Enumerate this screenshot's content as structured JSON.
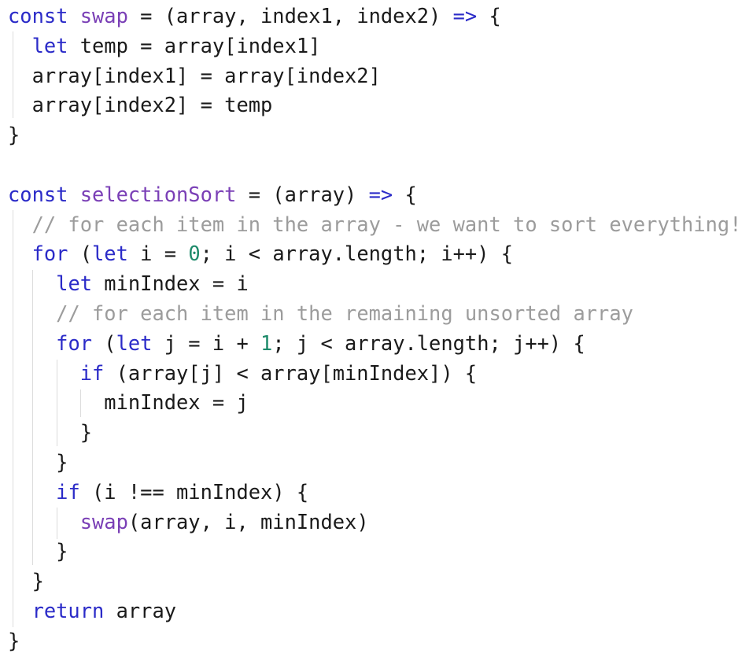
{
  "lines": [
    [
      {
        "t": "const ",
        "c": "kw"
      },
      {
        "t": "swap",
        "c": "fn"
      },
      {
        "t": " = (array, index1, index2) ",
        "c": ""
      },
      {
        "t": "=>",
        "c": "kw"
      },
      {
        "t": " {",
        "c": ""
      }
    ],
    [
      {
        "t": "  ",
        "c": ""
      },
      {
        "t": "let",
        "c": "kw"
      },
      {
        "t": " temp = array[index1]",
        "c": ""
      }
    ],
    [
      {
        "t": "  array[index1] = array[index2]",
        "c": ""
      }
    ],
    [
      {
        "t": "  array[index2] = temp",
        "c": ""
      }
    ],
    [
      {
        "t": "}",
        "c": ""
      }
    ],
    [
      {
        "t": "",
        "c": ""
      }
    ],
    [
      {
        "t": "const ",
        "c": "kw"
      },
      {
        "t": "selectionSort",
        "c": "fn"
      },
      {
        "t": " = (array) ",
        "c": ""
      },
      {
        "t": "=>",
        "c": "kw"
      },
      {
        "t": " {",
        "c": ""
      }
    ],
    [
      {
        "t": "  ",
        "c": ""
      },
      {
        "t": "// for each item in the array - we want to sort everything!",
        "c": "cm"
      }
    ],
    [
      {
        "t": "  ",
        "c": ""
      },
      {
        "t": "for",
        "c": "kw"
      },
      {
        "t": " (",
        "c": ""
      },
      {
        "t": "let",
        "c": "kw"
      },
      {
        "t": " i = ",
        "c": ""
      },
      {
        "t": "0",
        "c": "num"
      },
      {
        "t": "; i < array.length; i++) {",
        "c": ""
      }
    ],
    [
      {
        "t": "    ",
        "c": ""
      },
      {
        "t": "let",
        "c": "kw"
      },
      {
        "t": " minIndex = i",
        "c": ""
      }
    ],
    [
      {
        "t": "    ",
        "c": ""
      },
      {
        "t": "// for each item in the remaining unsorted array",
        "c": "cm"
      }
    ],
    [
      {
        "t": "    ",
        "c": ""
      },
      {
        "t": "for",
        "c": "kw"
      },
      {
        "t": " (",
        "c": ""
      },
      {
        "t": "let",
        "c": "kw"
      },
      {
        "t": " j = i + ",
        "c": ""
      },
      {
        "t": "1",
        "c": "num"
      },
      {
        "t": "; j < array.length; j++) {",
        "c": ""
      }
    ],
    [
      {
        "t": "      ",
        "c": ""
      },
      {
        "t": "if",
        "c": "kw"
      },
      {
        "t": " (array[j] < array[minIndex]) {",
        "c": ""
      }
    ],
    [
      {
        "t": "        minIndex = j",
        "c": ""
      }
    ],
    [
      {
        "t": "      }",
        "c": ""
      }
    ],
    [
      {
        "t": "    }",
        "c": ""
      }
    ],
    [
      {
        "t": "    ",
        "c": ""
      },
      {
        "t": "if",
        "c": "kw"
      },
      {
        "t": " (i !== minIndex) {",
        "c": ""
      }
    ],
    [
      {
        "t": "      ",
        "c": ""
      },
      {
        "t": "swap",
        "c": "fn"
      },
      {
        "t": "(array, i, minIndex)",
        "c": ""
      }
    ],
    [
      {
        "t": "    }",
        "c": ""
      }
    ],
    [
      {
        "t": "  }",
        "c": ""
      }
    ],
    [
      {
        "t": "  ",
        "c": ""
      },
      {
        "t": "return",
        "c": "kw"
      },
      {
        "t": " array",
        "c": ""
      }
    ],
    [
      {
        "t": "}",
        "c": ""
      }
    ]
  ],
  "colors": {
    "keyword": "#2b2bc8",
    "function": "#7a3fb6",
    "number": "#1d8a6a",
    "comment": "#9c9c9c",
    "text": "#1a1a1a",
    "indent_guide": "#dcdcdc",
    "background": "#ffffff"
  }
}
